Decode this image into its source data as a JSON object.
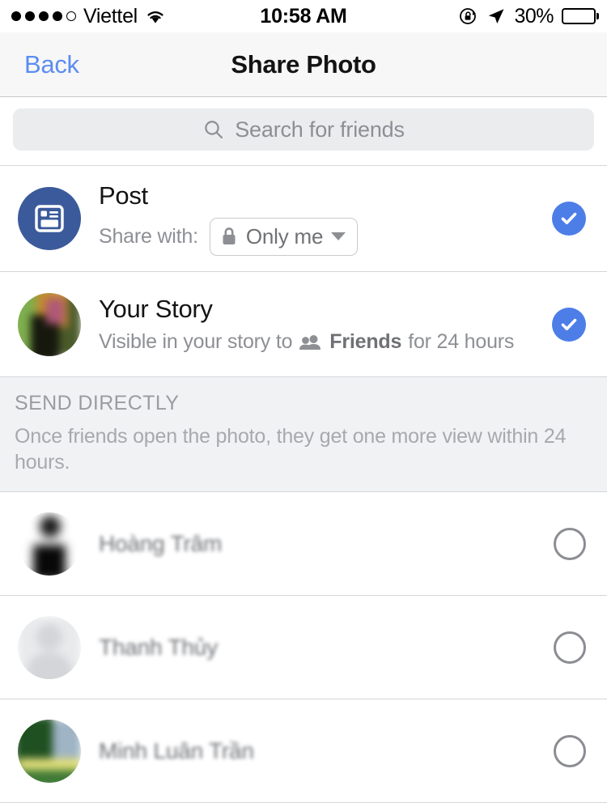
{
  "status_bar": {
    "signal_dots_filled": 4,
    "signal_dots_total": 5,
    "carrier": "Viettel",
    "wifi_icon": "wifi-icon",
    "time": "10:58 AM",
    "rotation_lock_icon": "rotation-lock-icon",
    "location_icon": "location-arrow-icon",
    "battery_percent": "30%",
    "battery_level": 30
  },
  "nav_bar": {
    "back_label": "Back",
    "title": "Share Photo"
  },
  "search": {
    "placeholder": "Search for friends",
    "value": "",
    "icon": "search-icon"
  },
  "share_targets": [
    {
      "name": "Post",
      "icon": "news-feed-icon",
      "icon_bg": "#3b5a9b",
      "subtitle_prefix": "Share with:",
      "privacy_label": "Only me",
      "privacy_icon": "lock-icon",
      "dropdown_icon": "chevron-down-icon",
      "selected": true,
      "selected_icon": "check-circle-icon"
    },
    {
      "name": "Your Story",
      "icon": "user-photo-avatar",
      "subtitle_prefix": "Visible in your story to",
      "audience_icon": "friends-group-icon",
      "audience_label": "Friends",
      "subtitle_suffix": "for 24 hours",
      "selected": true,
      "selected_icon": "check-circle-icon"
    }
  ],
  "send_directly": {
    "header": "SEND DIRECTLY",
    "description": "Once friends open the photo, they get one more view within 24 hours."
  },
  "friends": [
    {
      "name": "Hoàng Trâm",
      "avatar": "photo-avatar",
      "selected": false,
      "toggle_icon": "radio-circle-icon"
    },
    {
      "name": "Thanh Thủy",
      "avatar": "default-silhouette-avatar",
      "selected": false,
      "toggle_icon": "radio-circle-icon"
    },
    {
      "name": "Minh Luân Trần",
      "avatar": "landscape-photo-avatar",
      "selected": false,
      "toggle_icon": "radio-circle-icon"
    }
  ],
  "colors": {
    "accent_blue": "#4d7ee8",
    "link_blue": "#5b8def",
    "facebook_blue": "#3b5a9b",
    "section_bg": "#f1f2f4",
    "nav_bg": "#f7f7f8"
  }
}
